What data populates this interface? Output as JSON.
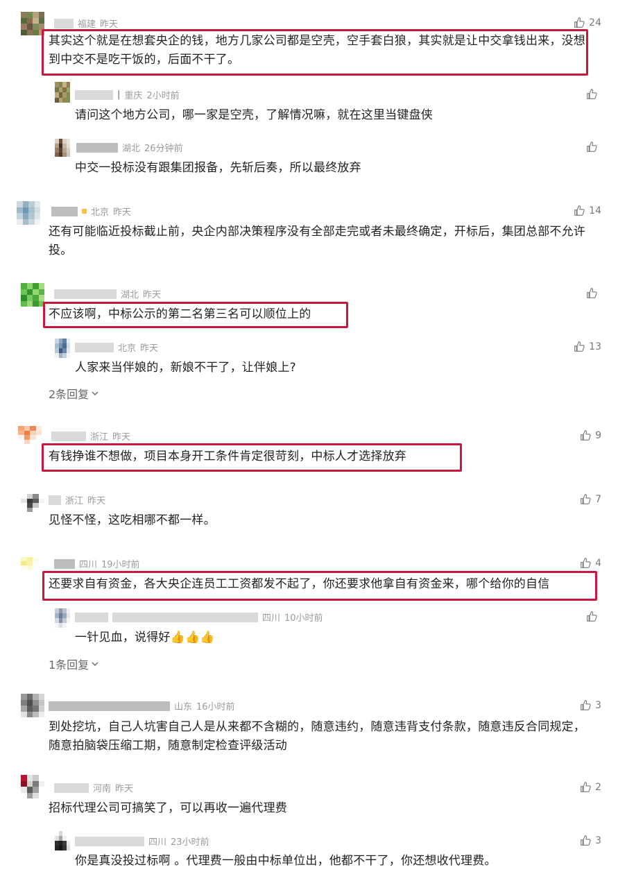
{
  "comments": [
    {
      "id": "c1",
      "location": "福建",
      "time": "昨天",
      "likes": "24",
      "text": "其实这个就是在想套央企的钱，地方几家公司都是空壳，空手套白狼，其实就是让中交拿钱出来，没想到中交不是吃干饭的，后面不干了。",
      "replies": [
        {
          "location": "重庆",
          "time": "2小时前",
          "likes": "",
          "text": "请问这个地方公司，哪一家是空壳，了解情况嘛，就在这里当键盘侠"
        },
        {
          "location": "湖北",
          "time": "26分钟前",
          "likes": "",
          "text": "中交一投标没有跟集团报备，先斩后奏，所以最终放弃"
        }
      ]
    },
    {
      "id": "c2",
      "location": "北京",
      "time": "昨天",
      "likes": "14",
      "text": "还有可能临近投标截止前，央企内部决策程序没有全部走完或者未最终确定，开标后，集团总部不允许投。"
    },
    {
      "id": "c3",
      "location": "湖北",
      "time": "昨天",
      "likes": "",
      "text": "不应该啊，中标公示的第二名第三名可以顺位上的",
      "replies": [
        {
          "location": "北京",
          "time": "昨天",
          "likes": "13",
          "text": "人家来当伴娘的，新娘不干了，让伴娘上?"
        }
      ],
      "more": "2条回复"
    },
    {
      "id": "c4",
      "location": "浙江",
      "time": "昨天",
      "likes": "9",
      "text": "有钱挣谁不想做，项目本身开工条件肯定很苛刻，中标人才选择放弃"
    },
    {
      "id": "c5",
      "location": "浙江",
      "time": "昨天",
      "likes": "7",
      "text": "见怪不怪，这吃相哪不都一样。"
    },
    {
      "id": "c6",
      "location": "四川",
      "time": "19小时前",
      "likes": "4",
      "text": "还要求自有资金，各大央企连员工工资都发不起了，你还要求他拿自有资金来，哪个给你的自信",
      "replies": [
        {
          "location": "四川",
          "time": "10小时前",
          "likes": "",
          "text": "一针见血，说得好",
          "emoji": "👍👍👍"
        }
      ],
      "more": "1条回复"
    },
    {
      "id": "c7",
      "location": "山东",
      "time": "16小时前",
      "likes": "3",
      "text": "到处挖坑，自己人坑害自己人是从来都不含糊的，随意违约，随意违背支付条款，随意违反合同规定，随意拍脑袋压缩工期，随意制定检查评级活动"
    },
    {
      "id": "c8",
      "location": "河南",
      "time": "昨天",
      "likes": "2",
      "text": "招标代理公司可搞笑了，可以再收一遍代理费",
      "replies": [
        {
          "location": "四川",
          "time": "23小时前",
          "likes": "3",
          "text": "你是真没投过标啊 。代理费一般由中标单位出，他都不干了，你还想收代理费。"
        }
      ]
    }
  ],
  "colors": {
    "highlight": "#c8183f",
    "meta": "#9a9a9a",
    "text": "#222222"
  },
  "icons": {
    "like": "thumbs-up-icon",
    "more": "chevron-down-icon"
  }
}
